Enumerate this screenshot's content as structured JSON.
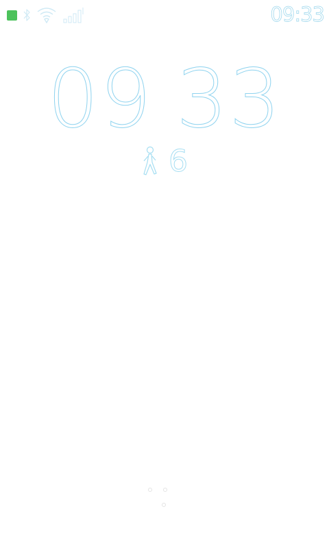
{
  "status_bar": {
    "time": "09:33",
    "icons": [
      "notification-square-icon",
      "bluetooth-icon",
      "wifi-icon",
      "signal-icon"
    ],
    "notification_color": "#4cc25b"
  },
  "clock": {
    "hours": "09",
    "minutes": "33"
  },
  "steps": {
    "icon": "walking-person-icon",
    "count": "6"
  },
  "colors": {
    "outline": "#8fd3ef",
    "background": "#ffffff"
  }
}
